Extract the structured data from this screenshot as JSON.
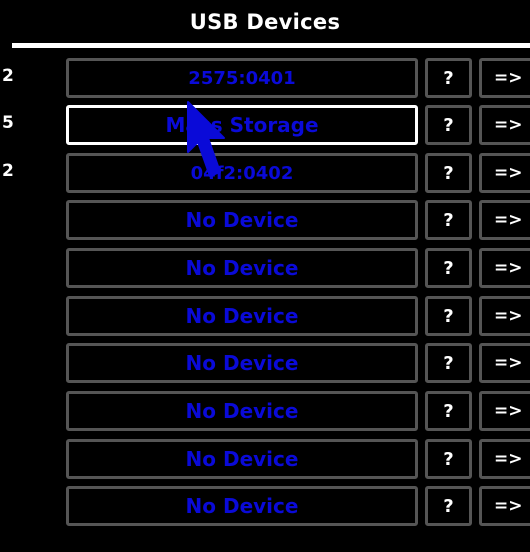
{
  "header": {
    "title": "USB Devices"
  },
  "colors": {
    "device_text": "#0a0ad8",
    "border": "#555555",
    "selected_border": "#ffffff"
  },
  "rows": [
    {
      "num": "2",
      "device": "2575:0401",
      "help": "?",
      "go": "=>"
    },
    {
      "num": "5",
      "device": "Mass Storage",
      "help": "?",
      "go": "=>"
    },
    {
      "num": "2",
      "device": "04f2:0402",
      "help": "?",
      "go": "=>"
    },
    {
      "num": "",
      "device": "No Device",
      "help": "?",
      "go": "=>"
    },
    {
      "num": "",
      "device": "No Device",
      "help": "?",
      "go": "=>"
    },
    {
      "num": "",
      "device": "No Device",
      "help": "?",
      "go": "=>"
    },
    {
      "num": "",
      "device": "No Device",
      "help": "?",
      "go": "=>"
    },
    {
      "num": "",
      "device": "No Device",
      "help": "?",
      "go": "=>"
    },
    {
      "num": "",
      "device": "No Device",
      "help": "?",
      "go": "=>"
    },
    {
      "num": "",
      "device": "No Device",
      "help": "?",
      "go": "=>"
    }
  ],
  "selected_row": 1,
  "cursor": {
    "icon": "mouse-pointer-icon"
  }
}
